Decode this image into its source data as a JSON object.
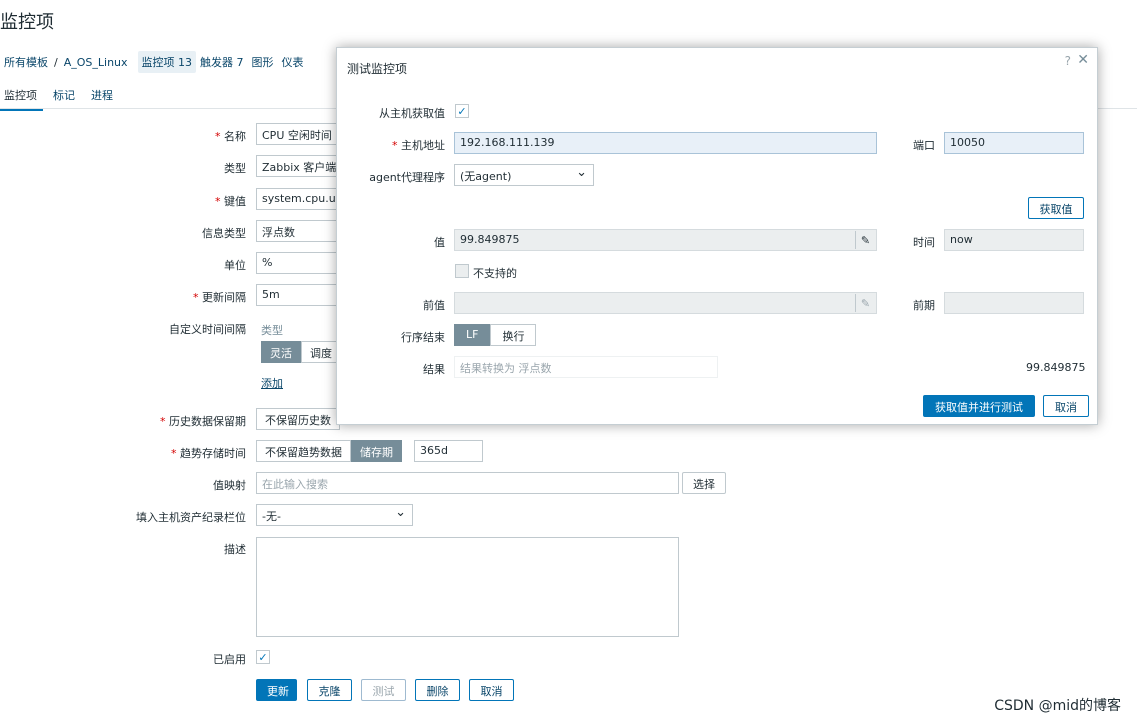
{
  "page_title": "监控项",
  "breadcrumb": {
    "all_templates": "所有模板",
    "sep": "/",
    "template": "A_OS_Linux",
    "items": "监控项 13",
    "triggers": "触发器 7",
    "graphs": "图形",
    "dashboards": "仪表"
  },
  "subtabs": [
    "监控项",
    "标记",
    "进程"
  ],
  "form": {
    "name_label": "名称",
    "name_value": "CPU 空闲时间",
    "type_label": "类型",
    "type_value": "Zabbix 客户端",
    "key_label": "键值",
    "key_value": "system.cpu.util",
    "info_type_label": "信息类型",
    "info_type_value": "浮点数",
    "unit_label": "单位",
    "unit_value": "%",
    "interval_label": "更新间隔",
    "interval_value": "5m",
    "custom_interval_label": "自定义时间间隔",
    "custom_interval_type_header": "类型",
    "custom_interval_flexible": "灵活",
    "custom_interval_scheduling": "调度",
    "custom_interval_add": "添加",
    "history_label": "历史数据保留期",
    "history_option": "不保留历史数",
    "trends_label": "趋势存储时间",
    "trends_no_keep": "不保留趋势数据",
    "trends_store": "储存期",
    "trends_value": "365d",
    "valuemap_label": "值映射",
    "valuemap_placeholder": "在此输入搜索",
    "valuemap_select": "选择",
    "inventory_label": "填入主机资产纪录栏位",
    "inventory_value": "-无-",
    "description_label": "描述",
    "enabled_label": "已启用",
    "enabled_check": "✓",
    "buttons": {
      "update": "更新",
      "clone": "克隆",
      "test": "测试",
      "delete": "删除",
      "cancel": "取消"
    }
  },
  "modal": {
    "title": "测试监控项",
    "help": "?",
    "close": "✕",
    "get_from_host_label": "从主机获取值",
    "get_from_host_check": "✓",
    "host_address_label": "主机地址",
    "host_address_value": "192.168.111.139",
    "port_label": "端口",
    "port_value": "10050",
    "proxy_label": "agent代理程序",
    "proxy_value": "(无agent)",
    "get_value_button": "获取值",
    "value_label": "值",
    "value_value": "99.849875",
    "time_label": "时间",
    "time_value": "now",
    "not_supported_label": "不支持的",
    "prev_value_label": "前值",
    "prev_time_label": "前期",
    "eol_label": "行序结束",
    "eol_lf": "LF",
    "eol_crlf": "换行",
    "result_label": "结果",
    "result_placeholder": "结果转换为 浮点数",
    "result_value": "99.849875",
    "get_and_test_button": "获取值并进行测试",
    "cancel_button": "取消"
  },
  "watermark": "CSDN @mid的博客",
  "icons": {
    "pencil": "pencil-icon",
    "chevron": "chevron-down-icon",
    "check": "check-icon",
    "help": "help-icon",
    "close": "close-icon"
  },
  "colors": {
    "accent": "#0275b8",
    "link": "#0a466a",
    "required": "#d40000",
    "segment_active": "#768d99"
  }
}
